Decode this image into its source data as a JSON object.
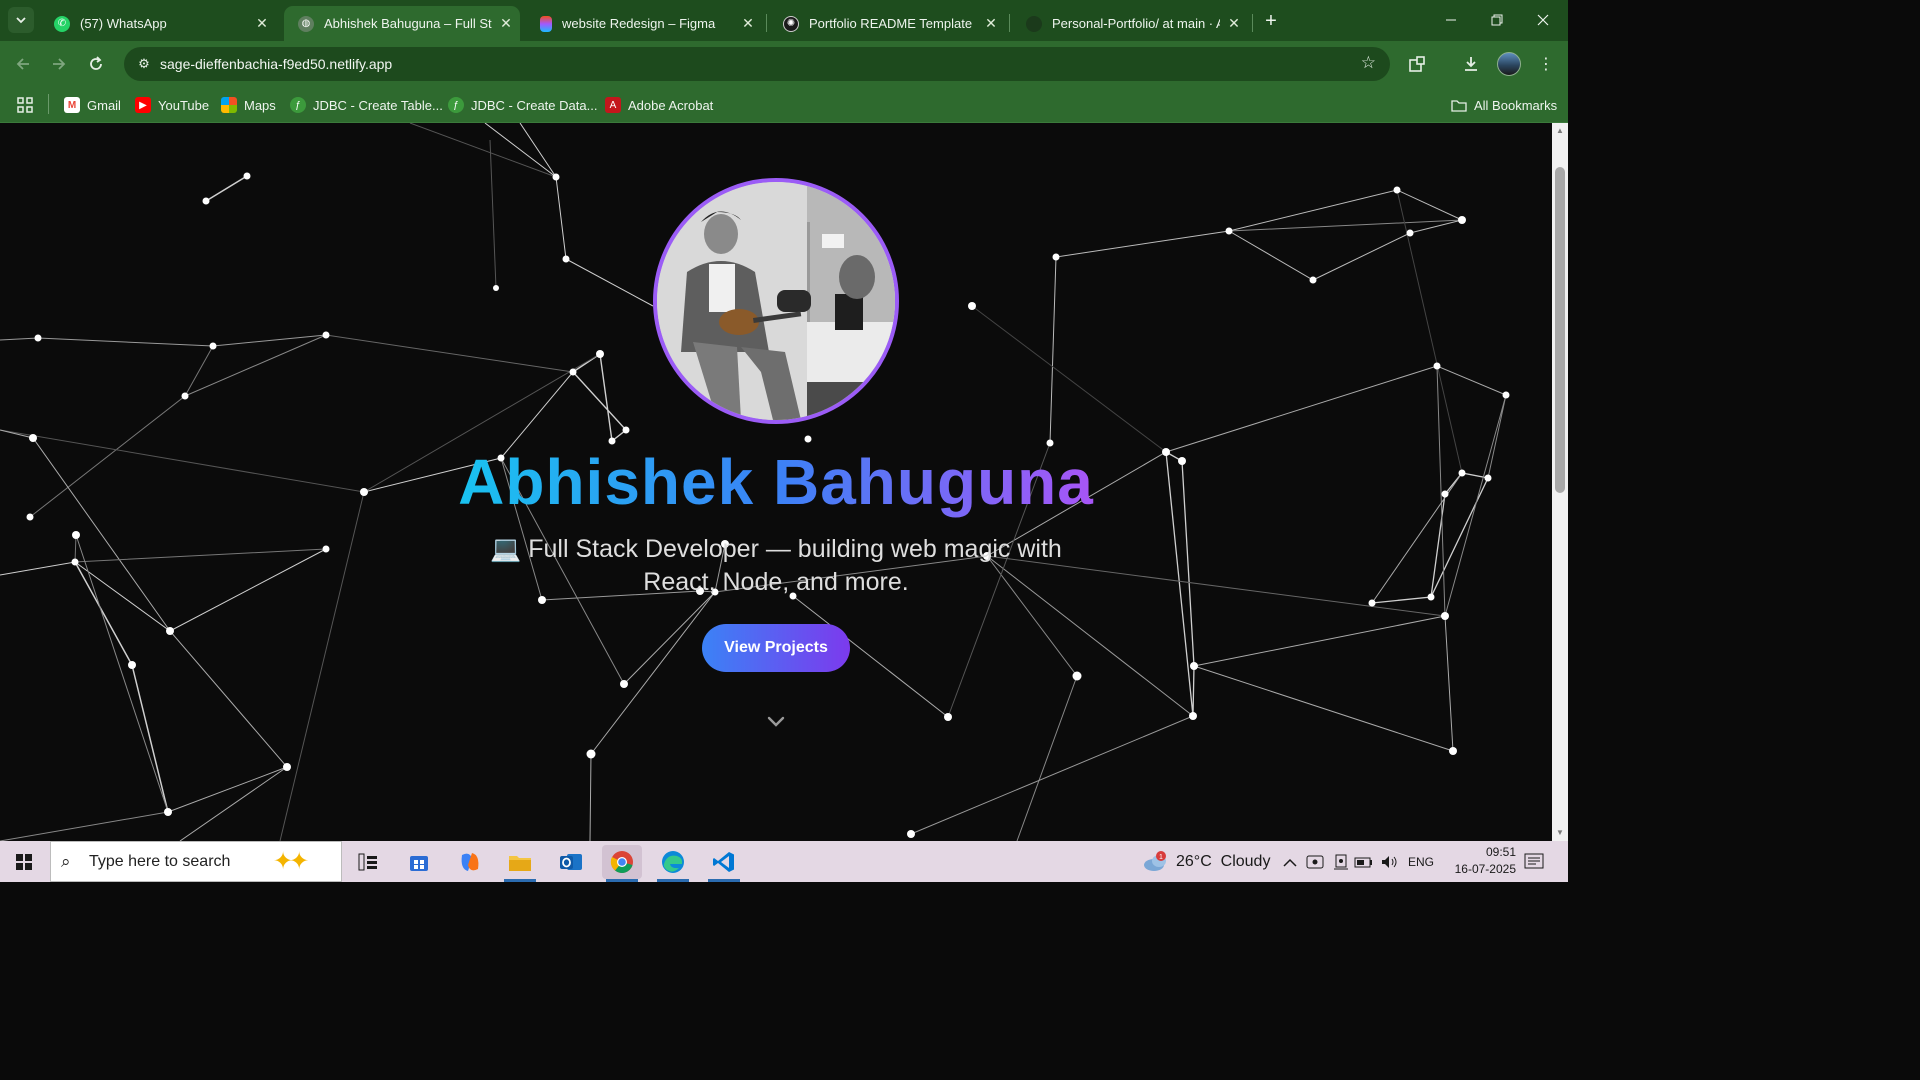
{
  "browser": {
    "tabs": [
      {
        "title": "(57) WhatsApp",
        "icon": "whatsapp-icon",
        "active": false
      },
      {
        "title": "Abhishek Bahuguna – Full Stack",
        "icon": "globe-icon",
        "active": true
      },
      {
        "title": "website Redesign – Figma",
        "icon": "figma-icon",
        "active": false
      },
      {
        "title": "Portfolio README Template",
        "icon": "openai-icon",
        "active": false
      },
      {
        "title": "Personal-Portfolio/ at main · Ab",
        "icon": "github-icon",
        "active": false
      }
    ],
    "url": "sage-dieffenbachia-f9ed50.netlify.app",
    "bookmarks": [
      "Gmail",
      "YouTube",
      "Maps",
      "JDBC - Create Table...",
      "JDBC - Create Data...",
      "Adobe Acrobat"
    ],
    "all_bookmarks": "All Bookmarks",
    "theme_color": "#2e6a2e"
  },
  "hero": {
    "name": "Abhishek Bahuguna",
    "tagline_line1": "💻 Full Stack Developer — building web magic with",
    "tagline_line2": "React, Node, and more.",
    "cta_label": "View Projects",
    "gradient": [
      "#19c3f0",
      "#3b82f6",
      "#a855f7"
    ],
    "ring_color": "#9b5cf6"
  },
  "taskbar": {
    "search_placeholder": "Type here to search",
    "weather": "26°C  Cloudy",
    "weather_alert": "1",
    "language": "ENG",
    "time": "09:51",
    "date": "16-07-2025"
  }
}
